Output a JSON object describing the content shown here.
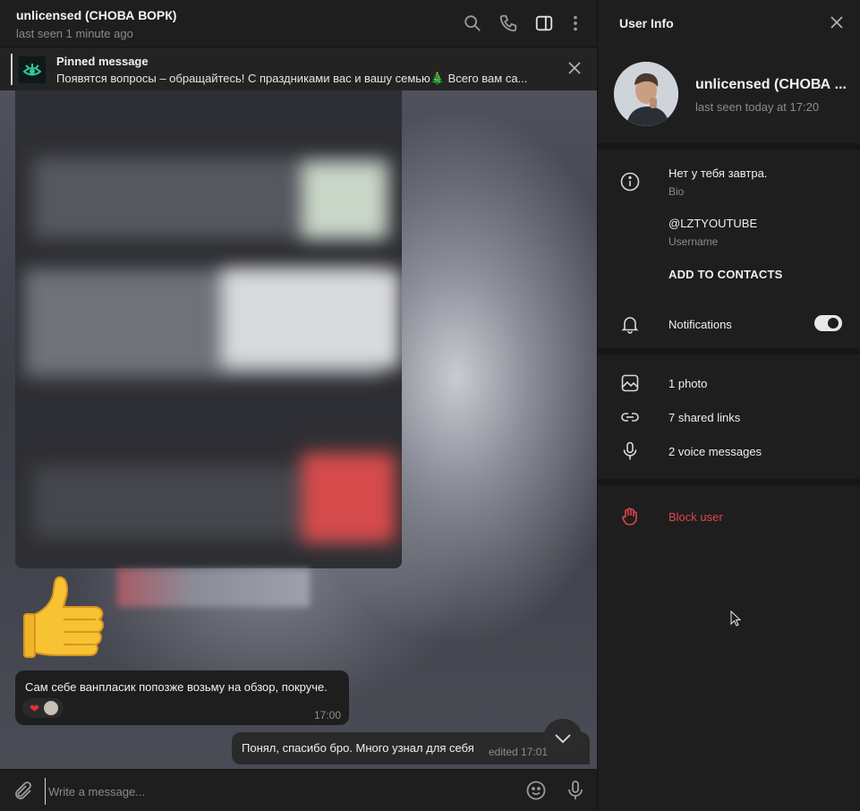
{
  "chat": {
    "title": "unlicensed (СНОВА ВОРК)",
    "status": "last seen 1 minute ago",
    "icons": [
      "search-icon",
      "phone-icon",
      "sidebar-toggle-icon",
      "more-vertical-icon"
    ]
  },
  "pinned": {
    "title": "Pinned message",
    "text": "Появятся вопросы – обращайтесь! С праздниками вас и вашу семью🎄 Всего вам са..."
  },
  "messages": {
    "incoming": {
      "text": "Сам себе ванпласик попозже возьму на обзор, покруче.",
      "time": "17:00",
      "reaction": "❤"
    },
    "outgoing": {
      "text": "Понял, спасибо бро. Много узнал для себя",
      "time": "edited 17:01"
    },
    "sticker": "thumbs-up-icon"
  },
  "composer": {
    "placeholder": "Write a message..."
  },
  "panel": {
    "title": "User Info",
    "name": "unlicensed (СНОВА ...",
    "status": "last seen today at 17:20",
    "bio": {
      "value": "Нет у тебя завтра.",
      "label": "Bio"
    },
    "username": {
      "value": "@LZTYOUTUBE",
      "label": "Username"
    },
    "add_contacts": "ADD TO CONTACTS",
    "notifications": {
      "label": "Notifications",
      "enabled": true
    },
    "media": {
      "photos": "1 photo",
      "links": "7 shared links",
      "voice": "2 voice messages"
    },
    "block": "Block user"
  },
  "colors": {
    "accent_danger": "#e0454a",
    "panel_bg": "#1e1e1e",
    "separator": "#161616"
  }
}
